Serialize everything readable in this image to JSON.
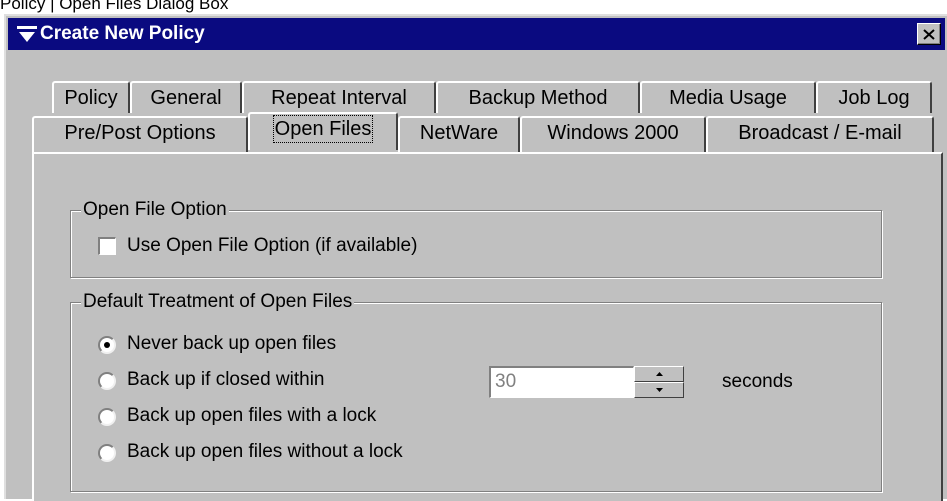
{
  "caption": "Policy | Open Files Dialog Box",
  "window": {
    "title": "Create New Policy",
    "title_icon": "menu-down-icon",
    "close_icon": "close-icon"
  },
  "tabs": {
    "row1": [
      "Policy",
      "General",
      "Repeat Interval",
      "Backup Method",
      "Media Usage",
      "Job Log"
    ],
    "row2": [
      "Pre/Post Options",
      "Open Files",
      "NetWare",
      "Windows 2000",
      "Broadcast / E-mail"
    ],
    "active": "Open Files"
  },
  "open_file_option": {
    "group_label": "Open File Option",
    "checkbox_label": "Use Open File Option (if available)",
    "checked": false
  },
  "default_treatment": {
    "group_label": "Default Treatment of Open Files",
    "options": [
      "Never back up open files",
      "Back up if closed within",
      "Back up open files with a lock",
      "Back up open files without a lock"
    ],
    "selected_index": 0,
    "seconds_value": "30",
    "seconds_label": "seconds"
  },
  "colors": {
    "titlebar": "#0a0a80",
    "face": "#c0c0c0"
  }
}
